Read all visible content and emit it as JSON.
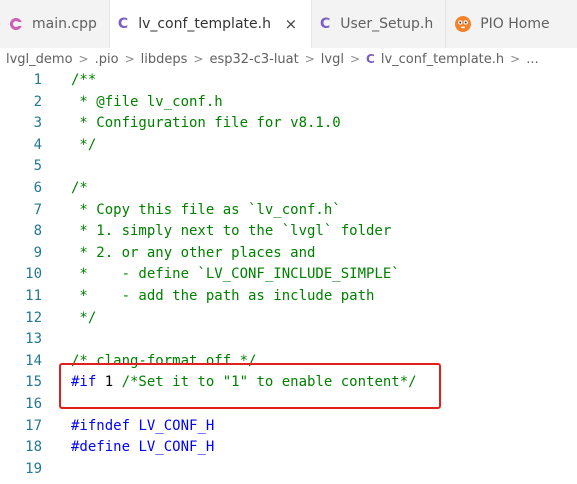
{
  "tabs": [
    {
      "label": "main.cpp",
      "icon": "cpp-file-icon",
      "active": false
    },
    {
      "label": "lv_conf_template.h",
      "icon": "c-file-icon",
      "active": true,
      "close": "×"
    },
    {
      "label": "User_Setup.h",
      "icon": "c-file-icon",
      "active": false
    },
    {
      "label": "PIO Home",
      "icon": "platformio-icon",
      "active": false
    }
  ],
  "breadcrumb": {
    "items": [
      "lvgl_demo",
      ".pio",
      "libdeps",
      "esp32-c3-luat",
      "lvgl"
    ],
    "file": "lv_conf_template.h",
    "tail": "..."
  },
  "editor": {
    "lines": [
      {
        "n": "1",
        "segments": [
          {
            "t": "/**",
            "c": "cmt"
          }
        ]
      },
      {
        "n": "2",
        "segments": [
          {
            "t": " * @file lv_conf.h",
            "c": "cmt"
          }
        ]
      },
      {
        "n": "3",
        "segments": [
          {
            "t": " * Configuration file for v8.1.0",
            "c": "cmt"
          }
        ]
      },
      {
        "n": "4",
        "segments": [
          {
            "t": " */",
            "c": "cmt"
          }
        ]
      },
      {
        "n": "5",
        "segments": []
      },
      {
        "n": "6",
        "segments": [
          {
            "t": "/*",
            "c": "cmt"
          }
        ]
      },
      {
        "n": "7",
        "segments": [
          {
            "t": " * Copy this file as `lv_conf.h`",
            "c": "cmt"
          }
        ]
      },
      {
        "n": "8",
        "segments": [
          {
            "t": " * 1. simply next to the `lvgl` folder",
            "c": "cmt"
          }
        ]
      },
      {
        "n": "9",
        "segments": [
          {
            "t": " * 2. or any other places and",
            "c": "cmt"
          }
        ]
      },
      {
        "n": "10",
        "segments": [
          {
            "t": " *    - define `LV_CONF_INCLUDE_SIMPLE`",
            "c": "cmt"
          }
        ]
      },
      {
        "n": "11",
        "segments": [
          {
            "t": " *    - add the path as include path",
            "c": "cmt"
          }
        ]
      },
      {
        "n": "12",
        "segments": [
          {
            "t": " */",
            "c": "cmt"
          }
        ]
      },
      {
        "n": "13",
        "segments": []
      },
      {
        "n": "14",
        "segments": [
          {
            "t": "/* clang-format off */",
            "c": "cmt"
          }
        ]
      },
      {
        "n": "15",
        "segments": [
          {
            "t": "#if ",
            "c": "kw"
          },
          {
            "t": "1 ",
            "c": "txt"
          },
          {
            "t": "/*Set it to \"1\" to enable content*/",
            "c": "cmt"
          }
        ]
      },
      {
        "n": "16",
        "segments": []
      },
      {
        "n": "17",
        "segments": [
          {
            "t": "#ifndef ",
            "c": "kw"
          },
          {
            "t": "LV_CONF_H",
            "c": "mac"
          }
        ]
      },
      {
        "n": "18",
        "segments": [
          {
            "t": "#define ",
            "c": "kw"
          },
          {
            "t": "LV_CONF_H",
            "c": "mac"
          }
        ]
      },
      {
        "n": "19",
        "segments": []
      }
    ]
  }
}
